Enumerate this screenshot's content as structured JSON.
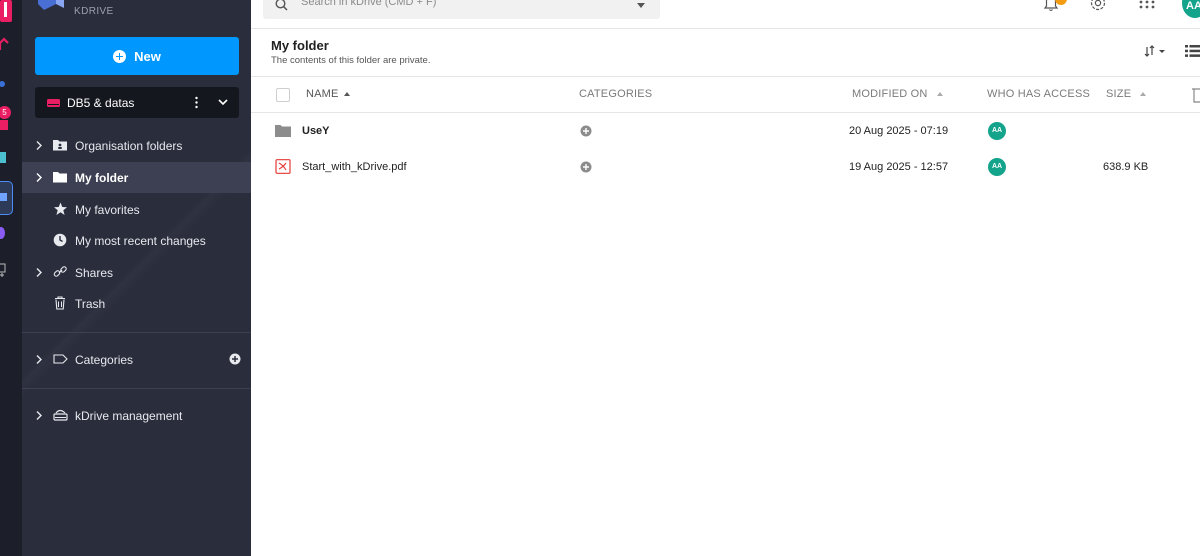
{
  "rail": {
    "badge": "5"
  },
  "sidebar": {
    "brand": "KDRIVE",
    "new_label": "New",
    "drive_name": "DB5 & datas",
    "items": [
      {
        "label": "Organisation folders",
        "icon": "organisation-folder-icon",
        "expandable": true,
        "active": false
      },
      {
        "label": "My folder",
        "icon": "folder-icon",
        "expandable": true,
        "active": true
      },
      {
        "label": "My favorites",
        "icon": "star-icon",
        "expandable": false,
        "active": false
      },
      {
        "label": "My most recent changes",
        "icon": "clock-icon",
        "expandable": false,
        "active": false
      },
      {
        "label": "Shares",
        "icon": "link-icon",
        "expandable": true,
        "active": false
      },
      {
        "label": "Trash",
        "icon": "trash-icon",
        "expandable": false,
        "active": false
      }
    ],
    "categories_label": "Categories",
    "management_label": "kDrive management"
  },
  "topbar": {
    "search_placeholder": "Search in kDrive (CMD + F)",
    "notification_count": "1",
    "avatar_initials": "AA"
  },
  "header": {
    "title": "My folder",
    "subtitle": "The contents of this folder are private."
  },
  "table": {
    "columns": {
      "name": "NAME",
      "categories": "CATEGORIES",
      "modified": "MODIFIED ON",
      "access": "WHO HAS ACCESS",
      "size": "SIZE"
    },
    "rows": [
      {
        "name": "UseY",
        "type": "folder",
        "modified": "20 Aug 2025 - 07:19",
        "access": "AA",
        "size": ""
      },
      {
        "name": "Start_with_kDrive.pdf",
        "type": "pdf",
        "modified": "19 Aug 2025 - 12:57",
        "access": "AA",
        "size": "638.9 KB"
      }
    ]
  },
  "colors": {
    "accent": "#0098ff",
    "sidebar_bg": "#2a2d3c",
    "avatar": "#14a38b",
    "notification": "#f39c12",
    "pdf": "#e53935"
  }
}
